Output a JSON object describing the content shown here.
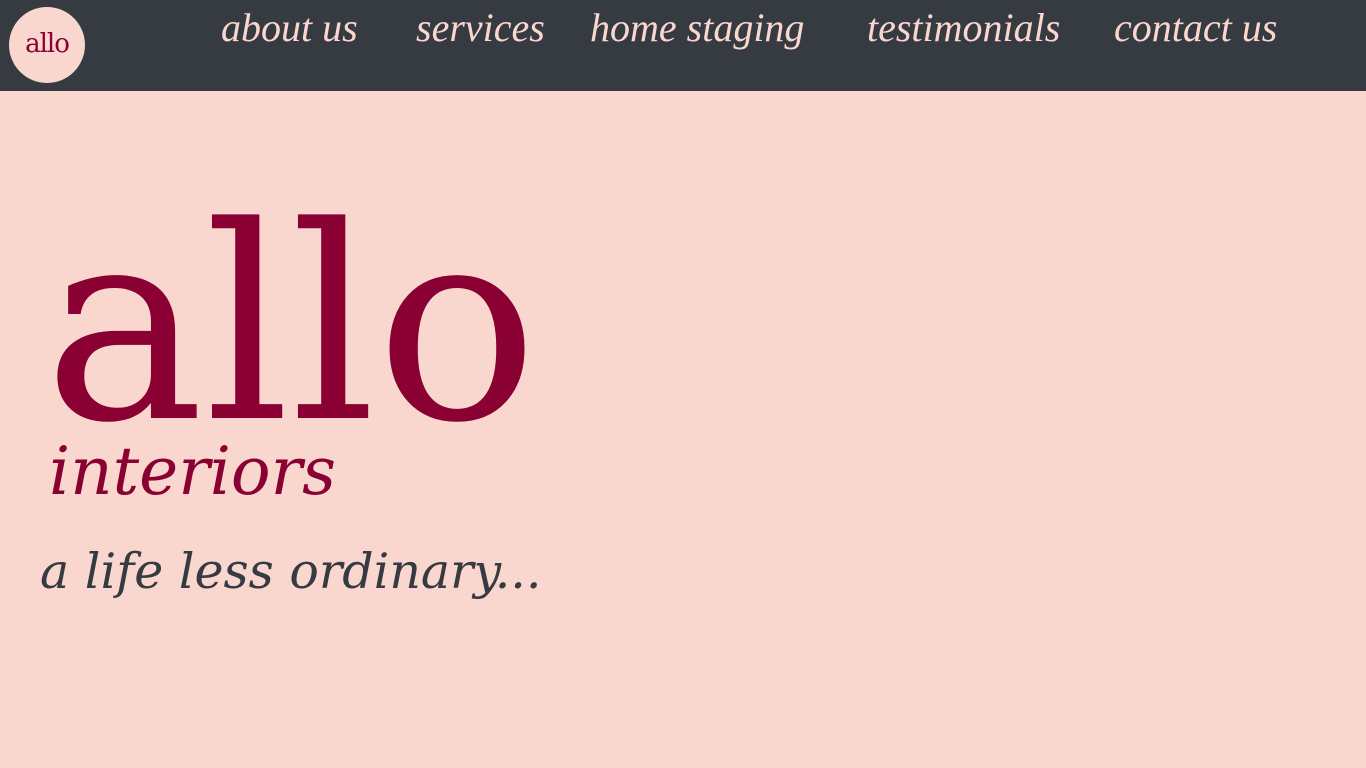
{
  "header": {
    "logo_text": "allo",
    "nav": [
      {
        "id": "about",
        "label": "about us"
      },
      {
        "id": "services",
        "label": "services"
      },
      {
        "id": "staging",
        "label": "home staging"
      },
      {
        "id": "testimonials",
        "label": "testimonials"
      },
      {
        "id": "contact",
        "label": "contact us"
      }
    ]
  },
  "hero": {
    "brand": "allo",
    "subtitle": "interiors",
    "tagline": "a life less ordinary..."
  },
  "colors": {
    "background": "#f9d7cf",
    "nav_background": "#363a41",
    "brand": "#8b0033",
    "tagline": "#363a41"
  }
}
